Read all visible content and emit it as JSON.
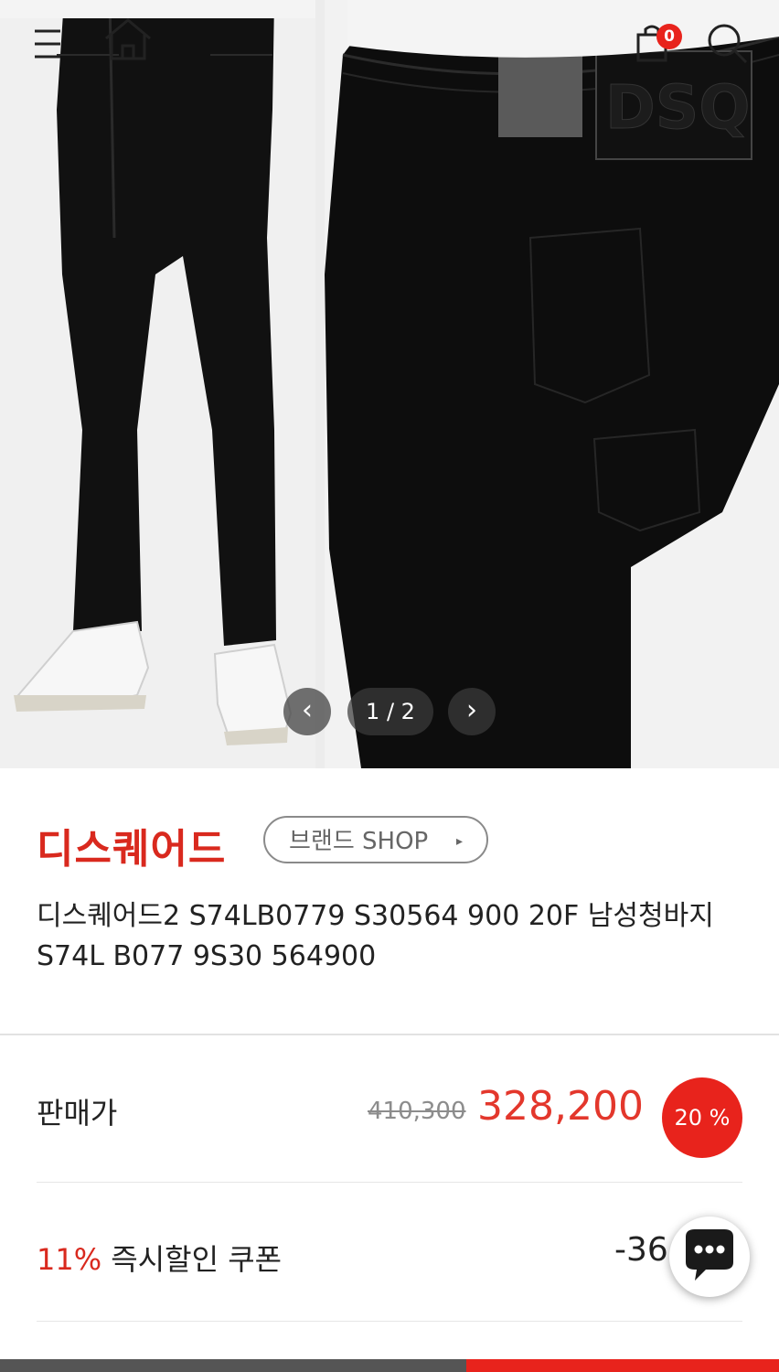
{
  "header": {
    "cart_count": "0"
  },
  "gallery": {
    "counter": "1 / 2",
    "prev_glyph": "‹",
    "next_glyph": "›",
    "label_tag_text": "DSQ"
  },
  "product": {
    "brand": "디스퀘어드",
    "brand_shop_label": "브랜드 SHOP",
    "brand_shop_arrow": "▸",
    "title": "디스퀘어드2 S74LB0779 S30564 900 20F 남성청바지 S74L B077 9S30 564900"
  },
  "price": {
    "label": "판매가",
    "original": "410,300",
    "sale": "328,200",
    "discount": "20 %"
  },
  "coupon": {
    "percent": "11%",
    "label": "즉시할인 쿠폰",
    "amount": "-36,1‥0"
  },
  "colors": {
    "accent": "#e8231c",
    "brand_red": "#d9291e",
    "bottom_bar_left": "#555555"
  }
}
